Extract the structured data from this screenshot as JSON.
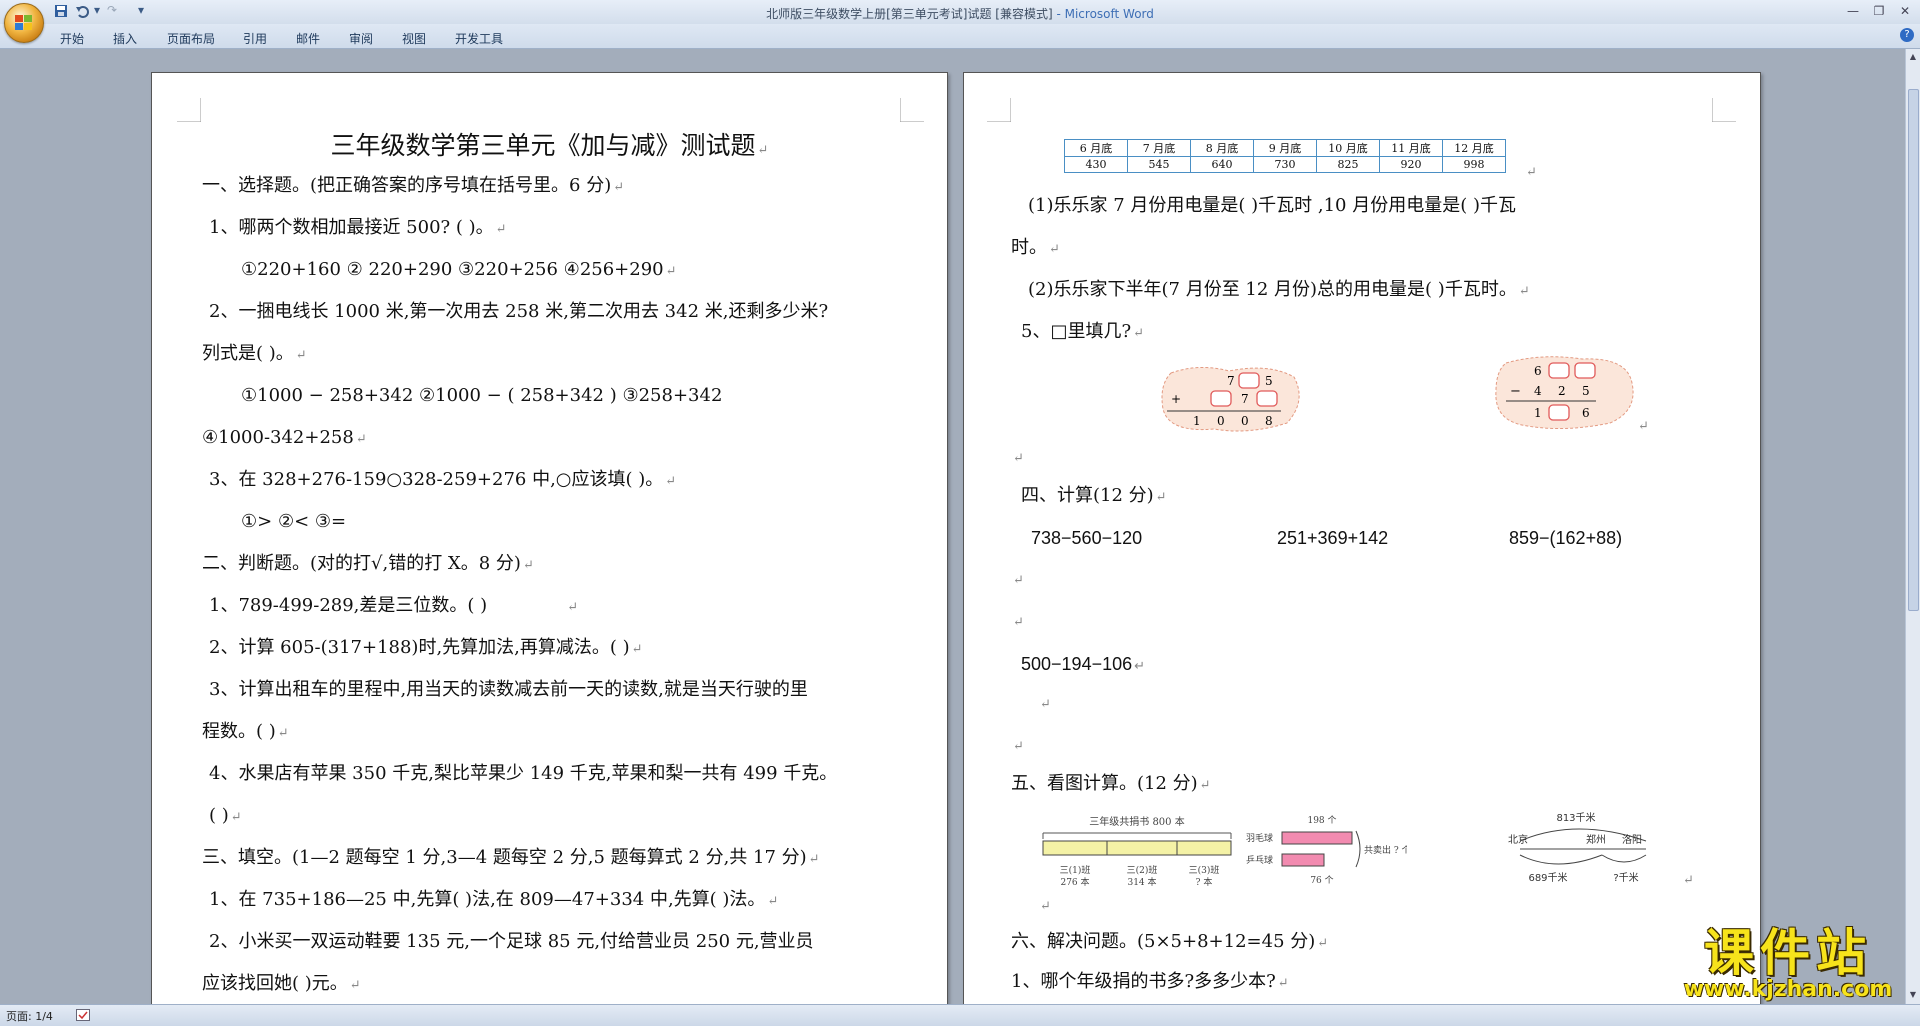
{
  "window": {
    "title": "北师版三年级数学上册[第三单元考试]试题 [兼容模式]",
    "app_suffix": " - Microsoft Word"
  },
  "quick_access": {
    "redo": "↷",
    "dropdown": "▾"
  },
  "ribbon_tabs": [
    "开始",
    "插入",
    "页面布局",
    "引用",
    "邮件",
    "审阅",
    "视图",
    "开发工具"
  ],
  "help": "?",
  "pilcrow": "↵",
  "page1": {
    "title": "三年级数学第三单元《加与减》测试题",
    "lines": [
      "一、选择题。(把正确答案的序号填在括号里。6 分)",
      "1、哪两个数相加最接近 500? (        )。",
      "①220+160      ② 220+290      ③220+256      ④256+290",
      "2、一捆电线长 1000 米,第一次用去 258 米,第二次用去 342 米,还剩多少米?",
      "列式是(        )。",
      "①1000 − 258+342              ②1000 − ( 258+342 )                     ③258+342",
      "④1000-342+258",
      "3、在 328+276-159○328-259+276 中,○应该填(        )。",
      "①>                  ②<                  ③=",
      "二、判断题。(对的打√,错的打 X。8 分)",
      "1、789-499-289,差是三位数。(      )",
      "2、计算 605-(317+188)时,先算加法,再算减法。(   )",
      "3、计算出租车的里程中,用当天的读数减去前一天的读数,就是当天行驶的里",
      "程数。(       )",
      "4、水果店有苹果 350 千克,梨比苹果少 149 千克,苹果和梨一共有 499 千克。",
      "(         )",
      "三、填空。(1—2 题每空 1 分,3—4 题每空 2 分,5 题每算式 2 分,共 17 分)",
      "1、在 735+186—25 中,先算(      )法,在 809—47+334 中,先算(      )法。",
      "2、小米买一双运动鞋要 135 元,一个足球 85 元,付给营业员 250 元,营业员",
      "应该找回她(           )元。"
    ]
  },
  "page2": {
    "table": {
      "headers": [
        "6 月底",
        "7 月底",
        "8 月底",
        "9 月底",
        "10 月底",
        "11 月底",
        "12 月底"
      ],
      "values": [
        "430",
        "545",
        "640",
        "730",
        "825",
        "920",
        "998"
      ]
    },
    "lines": [
      "(1)乐乐家 7 月份用电量是(          )千瓦时 ,10 月份用电量是(          )千瓦",
      "时。",
      "(2)乐乐家下半年(7 月份至 12 月份)总的用电量是(         )千瓦时。",
      "5、□里填几?",
      "四、计算(12 分)",
      "738−560−120",
      "251+369+142",
      "859−(162+88)",
      "500−194−106",
      "五、看图计算。(12 分)",
      "六、解决问题。(5×5+8+12=45 分)",
      "1、哪个年级捐的书多?多多少本?"
    ],
    "puzzle1": {
      "row1": [
        "7",
        "5"
      ],
      "row2": [
        "+",
        "7"
      ],
      "sum": [
        "1",
        "0",
        "0",
        "8"
      ]
    },
    "puzzle2": {
      "row1": [
        "6"
      ],
      "row2": [
        "−",
        "4",
        "2",
        "5"
      ],
      "sum": [
        "1",
        "6"
      ]
    },
    "books_figure": {
      "caption_top": "三年级共捐书 800 本",
      "labels": [
        "三(1)班",
        "三(2)班",
        "三(3)班"
      ],
      "values": [
        "276 本",
        "314 本",
        "? 本"
      ]
    },
    "sport_figure": {
      "items": [
        "羽毛球",
        "乒乓球"
      ],
      "top_value": "198 个",
      "bottom_value": "76 个",
      "total": "共卖出 ? 个"
    },
    "route_figure": {
      "top": "813千米",
      "places": [
        "北京",
        "郑州",
        "洛阳"
      ],
      "left": "689千米",
      "right": "?千米"
    }
  },
  "status": {
    "page": "页面: 1/4"
  },
  "watermark": {
    "text": "课件站",
    "url": "www.kjzhan.com"
  }
}
